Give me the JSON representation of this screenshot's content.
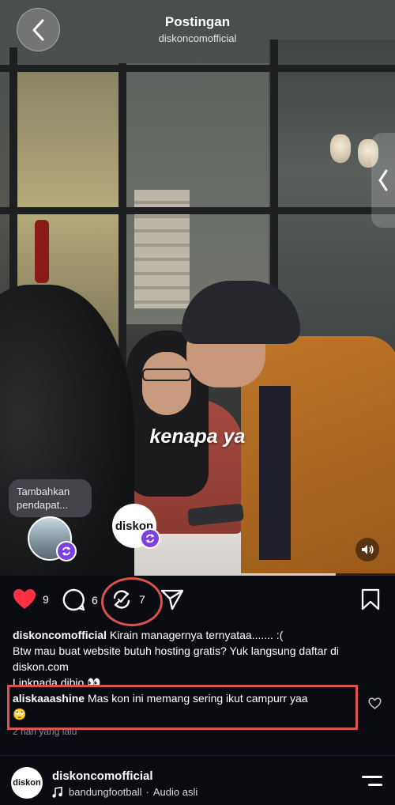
{
  "header": {
    "title": "Postingan",
    "subtitle": "diskoncomofficial"
  },
  "video": {
    "overlay_text": "kenapa ya",
    "note_bubble": "Tambahkan pendapat...",
    "brand_avatar_text": "diskon"
  },
  "actions": {
    "likes": "9",
    "comments": "6",
    "reposts": "7",
    "like_color": "#ff3040",
    "highlight_color": "#d9534a"
  },
  "caption": {
    "username": "diskoncomofficial",
    "first_line": "Kirain managernya ternyataa....... :(",
    "line2": "Btw mau buat website butuh hosting gratis? Yuk langsung daftar di diskon.com",
    "line3": "Linknada dibio 👀"
  },
  "comment": {
    "username": "aliskaaashine",
    "text": "Mas kon ini memang sering ikut campurr yaa",
    "emoji": "🙄",
    "time": "2 hari yang lalu"
  },
  "audio": {
    "account": "diskoncomofficial",
    "avatar_text": "diskon",
    "track": "bandungfootball",
    "separator": "·",
    "type": "Audio asli"
  }
}
